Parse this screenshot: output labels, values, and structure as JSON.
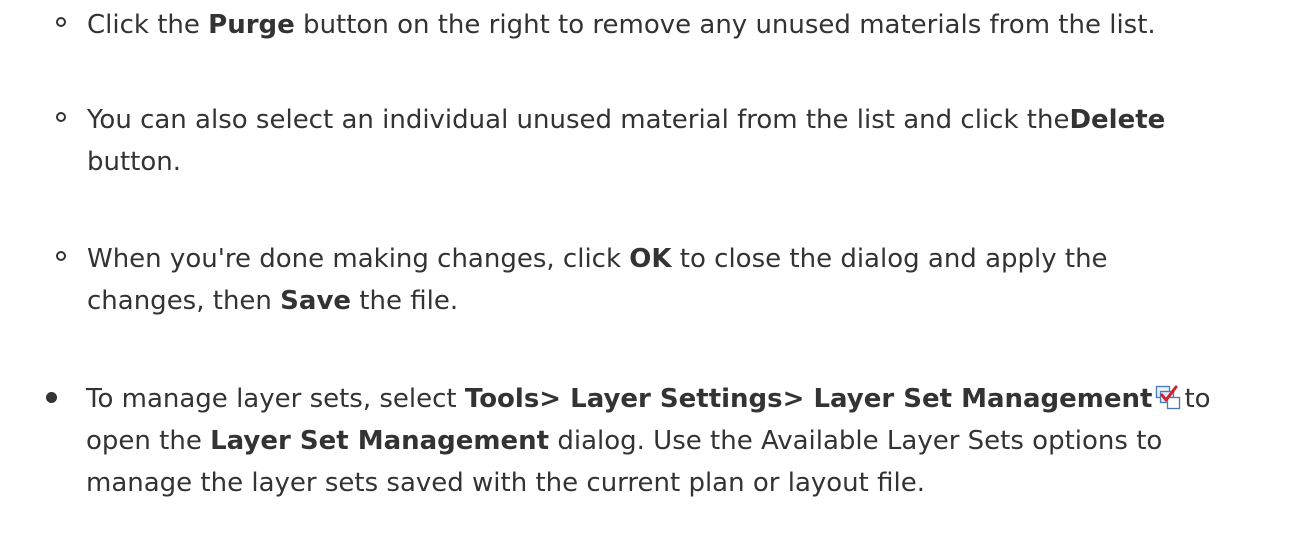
{
  "items": [
    {
      "type": "sub",
      "lines": [
        [
          {
            "t": "Click the "
          },
          {
            "t": "Purge",
            "b": true
          },
          {
            "t": " button on the right to remove any unused materials from the list."
          }
        ]
      ]
    },
    {
      "type": "sub",
      "lines": [
        [
          {
            "t": "You can also select an individual unused material from the list and click the"
          },
          {
            "t": "Delete",
            "b": true
          }
        ],
        [
          {
            "t": "button."
          }
        ]
      ]
    },
    {
      "type": "sub",
      "lines": [
        [
          {
            "t": "When you're done making changes, click "
          },
          {
            "t": "OK",
            "b": true
          },
          {
            "t": " to close the dialog and apply the"
          }
        ],
        [
          {
            "t": "changes, then "
          },
          {
            "t": "Save",
            "b": true
          },
          {
            "t": " the file."
          }
        ]
      ]
    },
    {
      "type": "main",
      "lines": [
        [
          {
            "t": "To manage layer sets, select "
          },
          {
            "t": "Tools> Layer Settings> Layer Set Management",
            "b": true
          },
          {
            "icon": "layer-set-management-icon"
          },
          {
            "t": "to"
          }
        ],
        [
          {
            "t": "open the "
          },
          {
            "t": "Layer Set Management",
            "b": true
          },
          {
            "t": " dialog. Use the Available Layer Sets options to"
          }
        ],
        [
          {
            "t": "manage the layer sets saved with the current plan or layout file."
          }
        ]
      ]
    }
  ]
}
